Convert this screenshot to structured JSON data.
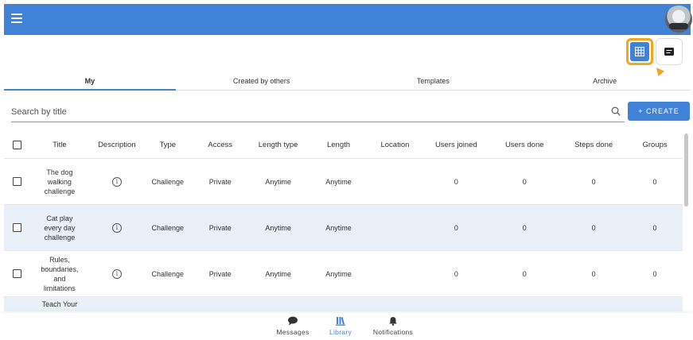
{
  "colors": {
    "primary": "#3f82d8",
    "highlight": "#f4a51c",
    "row_highlight": "#e9f0f8"
  },
  "appbar": {
    "menu_icon": "hamburger-menu-icon",
    "avatar_icon": "user-avatar"
  },
  "view_toggle": {
    "grid_icon": "table-grid-icon",
    "list_icon": "card-list-icon"
  },
  "tabs": [
    {
      "label": "My",
      "active": true
    },
    {
      "label": "Created by others",
      "active": false
    },
    {
      "label": "Templates",
      "active": false
    },
    {
      "label": "Archive",
      "active": false
    }
  ],
  "search": {
    "placeholder": "Search by title",
    "value": ""
  },
  "create_button": {
    "label": "+ CREATE"
  },
  "table": {
    "columns": [
      "Title",
      "Description",
      "Type",
      "Access",
      "Length type",
      "Length",
      "Location",
      "Users joined",
      "Users done",
      "Steps done",
      "Groups"
    ],
    "rows": [
      {
        "title": "The dog walking challenge",
        "type": "Challenge",
        "access": "Private",
        "length_type": "Anytime",
        "length": "Anytime",
        "location": "",
        "users_joined": "0",
        "users_done": "0",
        "steps_done": "0",
        "groups": "0"
      },
      {
        "title": "Cat play every day challenge",
        "type": "Challenge",
        "access": "Private",
        "length_type": "Anytime",
        "length": "Anytime",
        "location": "",
        "users_joined": "0",
        "users_done": "0",
        "steps_done": "0",
        "groups": "0"
      },
      {
        "title": "Rules, boundaries, and limitations",
        "type": "Challenge",
        "access": "Private",
        "length_type": "Anytime",
        "length": "Anytime",
        "location": "",
        "users_joined": "0",
        "users_done": "0",
        "steps_done": "0",
        "groups": "0"
      },
      {
        "title": "Teach Your",
        "type": "",
        "access": "",
        "length_type": "",
        "length": "",
        "location": "",
        "users_joined": "",
        "users_done": "",
        "steps_done": "",
        "groups": ""
      }
    ]
  },
  "bottom_nav": [
    {
      "label": "Messages",
      "icon": "chat-bubble-icon",
      "active": false
    },
    {
      "label": "Library",
      "icon": "library-books-icon",
      "active": true
    },
    {
      "label": "Notifications",
      "icon": "bell-icon",
      "active": false
    }
  ]
}
